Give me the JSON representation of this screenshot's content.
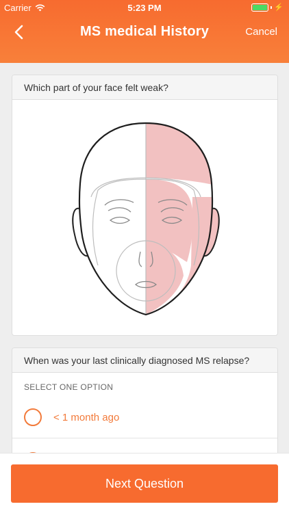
{
  "status_bar": {
    "carrier": "Carrier",
    "time": "5:23 PM"
  },
  "nav": {
    "title": "MS medical History",
    "cancel_label": "Cancel"
  },
  "question1": {
    "text": "Which part of your face felt weak?"
  },
  "question2": {
    "text": "When was your last clinically diagnosed MS relapse?",
    "select_label": "SELECT ONE OPTION",
    "options": [
      {
        "label": "< 1 month ago"
      },
      {
        "label": ""
      }
    ]
  },
  "footer": {
    "next_label": "Next Question"
  },
  "colors": {
    "accent": "#f76b2f",
    "highlight": "#f2c1c1",
    "battery": "#4cd964"
  },
  "icons": [
    "wifi-icon",
    "battery-icon",
    "back-chevron-icon",
    "radio-icon"
  ]
}
